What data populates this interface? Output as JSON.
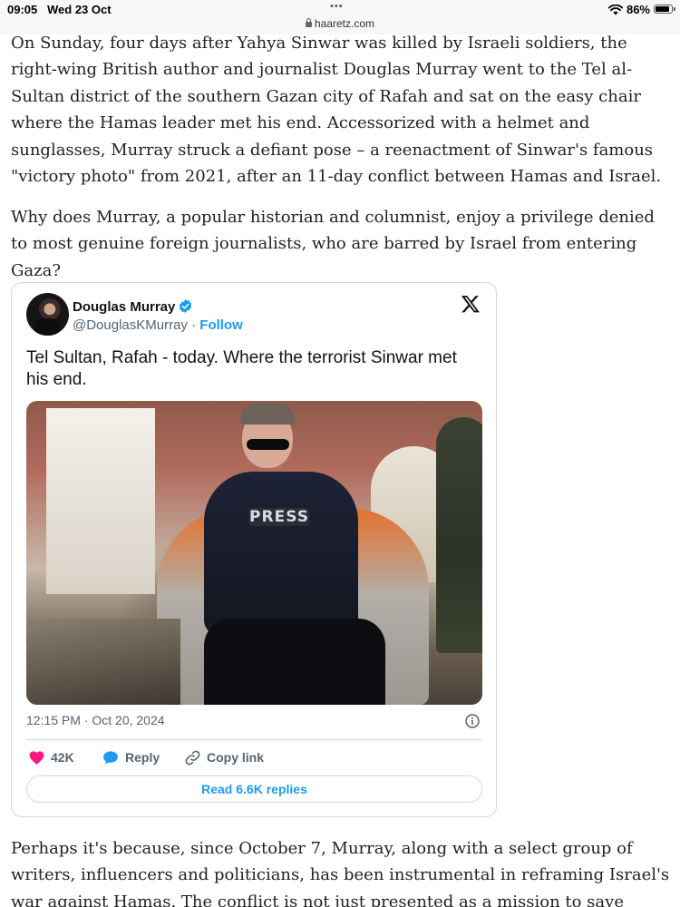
{
  "status_bar": {
    "time": "09:05",
    "date": "Wed 23 Oct",
    "url": "haaretz.com",
    "battery_percent": "86%",
    "battery_level": 0.86,
    "tab_dots": "•••"
  },
  "article": {
    "paragraph_1": "On Sunday, four days after Yahya Sinwar was killed by Israeli soldiers, the right-wing British author and journalist Douglas Murray went to the Tel al-Sultan district of the southern Gazan city of Rafah and sat on the easy chair where the Hamas leader met his end. Accessorized with a helmet and sunglasses, Murray struck a defiant pose – a reenactment of Sinwar's famous \"victory photo\" from 2021, after an 11-day conflict between Hamas and Israel.",
    "paragraph_2": "Why does Murray, a popular historian and columnist, enjoy a privilege denied to most genuine foreign journalists, who are barred by Israel from entering Gaza?",
    "paragraph_3": "Perhaps it's because, since October 7, Murray, along with a select group of writers, influencers and politicians, has been instrumental in reframing Israel's war against Hamas. The conflict is not just presented as a mission to save hostages, to"
  },
  "tweet": {
    "author_name": "Douglas Murray",
    "handle": "@DouglasKMurray",
    "separator": " · ",
    "follow_label": "Follow",
    "text": "Tel Sultan, Rafah - today. Where the terrorist Sinwar met his end.",
    "photo_text": "PRESS",
    "timestamp": "12:15 PM · Oct 20, 2024",
    "like_count": "42K",
    "reply_label": "Reply",
    "copy_link_label": "Copy link",
    "read_replies_label": "Read 6.6K replies"
  },
  "colors": {
    "link_blue": "#1d9bf0",
    "like_pink": "#f91880",
    "muted_gray": "#536471",
    "border": "#cfd9de"
  },
  "icons": [
    "lock-icon",
    "wifi-icon",
    "battery-icon",
    "verified-badge-icon",
    "x-logo-icon",
    "info-icon",
    "heart-icon",
    "reply-bubble-icon",
    "link-icon"
  ]
}
